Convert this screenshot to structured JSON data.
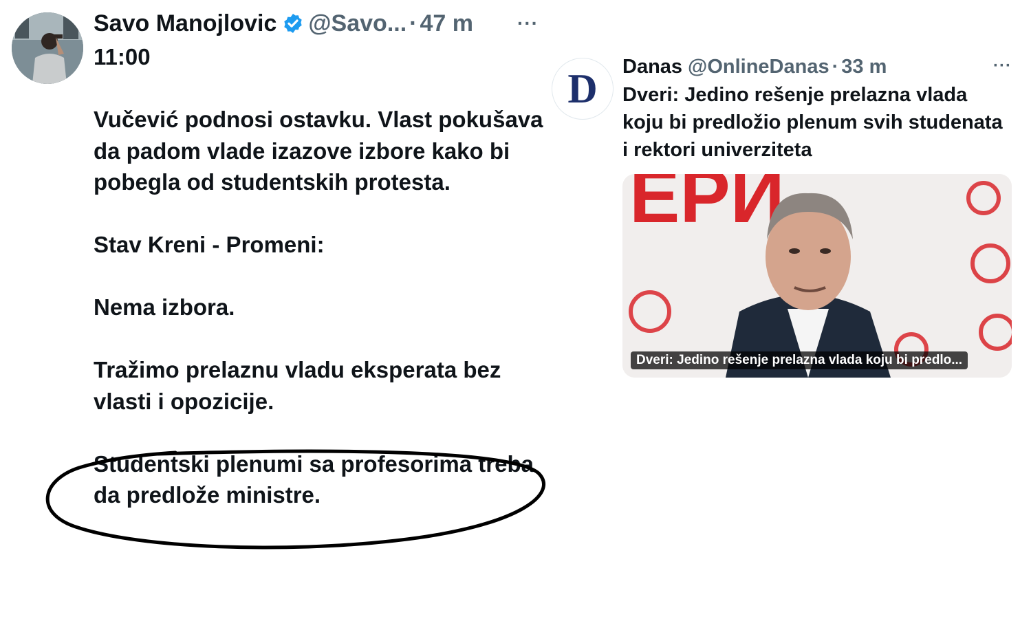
{
  "left_tweet": {
    "author_name": "Savo Manojlovic",
    "handle": "@Savo...",
    "separator": "·",
    "timestamp": "47 m",
    "more_label": "···",
    "lines": [
      "11:00",
      "",
      "Vučević podnosi ostavku. Vlast pokušava da padom vlade izazove izbore kako bi pobegla od studentskih protesta.",
      "",
      "Stav Kreni - Promeni:",
      "",
      "Nema izbora.",
      "",
      "Tražimo prelaznu vladu eksperata bez vlasti i opozicije.",
      "",
      "Studentski plenumi sa profesorima treba da predlože ministre."
    ],
    "verified_color": "#1d9bf0",
    "annotation_color": "#000000"
  },
  "right_tweet": {
    "author_name": "Danas",
    "handle": "@OnlineDanas",
    "separator": "·",
    "timestamp": "33 m",
    "more_label": "···",
    "avatar_letter": "D",
    "text": "Dveri: Jedino rešenje prelazna vlada koju bi predložio plenum svih studenata i rektori univerziteta",
    "card_caption": "Dveri: Jedino rešenje prelazna vlada koju bi predlo...",
    "card_banner_text": "ЕРИ",
    "brand_color": "#1d2f6b",
    "banner_color": "#d9262b"
  }
}
